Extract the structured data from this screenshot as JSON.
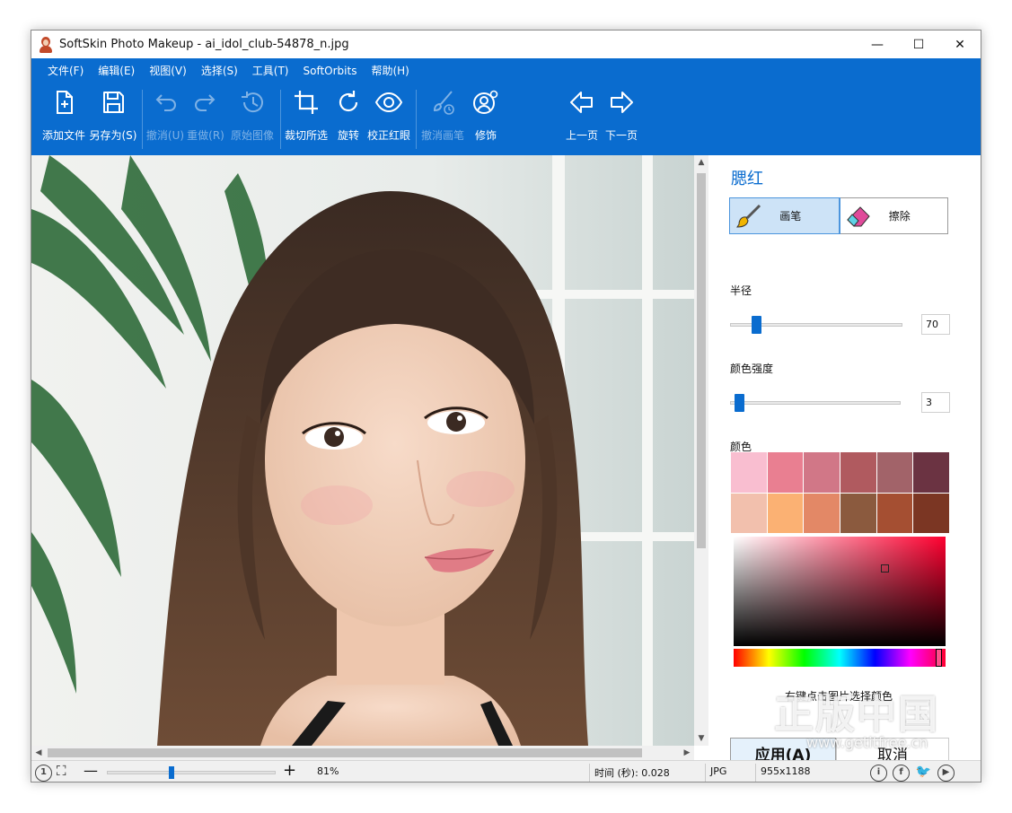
{
  "window": {
    "title": "SoftSkin Photo Makeup - ai_idol_club-54878_n.jpg",
    "controls": {
      "minimize": "—",
      "maximize": "☐",
      "close": "✕"
    }
  },
  "menu": [
    "文件(F)",
    "编辑(E)",
    "视图(V)",
    "选择(S)",
    "工具(T)",
    "SoftOrbits",
    "帮助(H)"
  ],
  "toolbar": {
    "add_file": "添加文件",
    "save_as": "另存为(S)",
    "undo": "撤消(U)",
    "redo": "重做(R)",
    "original": "原始图像",
    "crop": "裁切所选",
    "rotate": "旋转",
    "red_eye": "校正红眼",
    "undo_brush": "撤消画笔",
    "retouch": "修饰",
    "prev": "上一页",
    "next": "下一页"
  },
  "panel": {
    "title": "腮红",
    "brush": "画笔",
    "erase": "擦除",
    "radius_label": "半径",
    "radius_value": "70",
    "radius_fraction": 0.13,
    "intensity_label": "颜色强度",
    "intensity_value": "3",
    "intensity_fraction": 0.03,
    "color_label": "颜色",
    "swatches": [
      "#f9bed0",
      "#e97f91",
      "#d17787",
      "#b05a5f",
      "#a26369",
      "#6b3342",
      "#f2c0ad",
      "#fbb173",
      "#e38866",
      "#8b5a3e",
      "#a54f32",
      "#7b3623"
    ],
    "hint": "右键点击图片选择颜色",
    "apply": "应用(A)",
    "cancel": "取消"
  },
  "statusbar": {
    "zoom": "81%",
    "zoom_fraction": 0.38,
    "time": "时间 (秒): 0.028",
    "format": "JPG",
    "dimensions": "955x1188"
  },
  "watermark": {
    "main": "正版中国",
    "url": "www.getitfree.cn"
  },
  "colors": {
    "accent": "#0a6ccf",
    "panel_title": "#0a6ccf"
  }
}
